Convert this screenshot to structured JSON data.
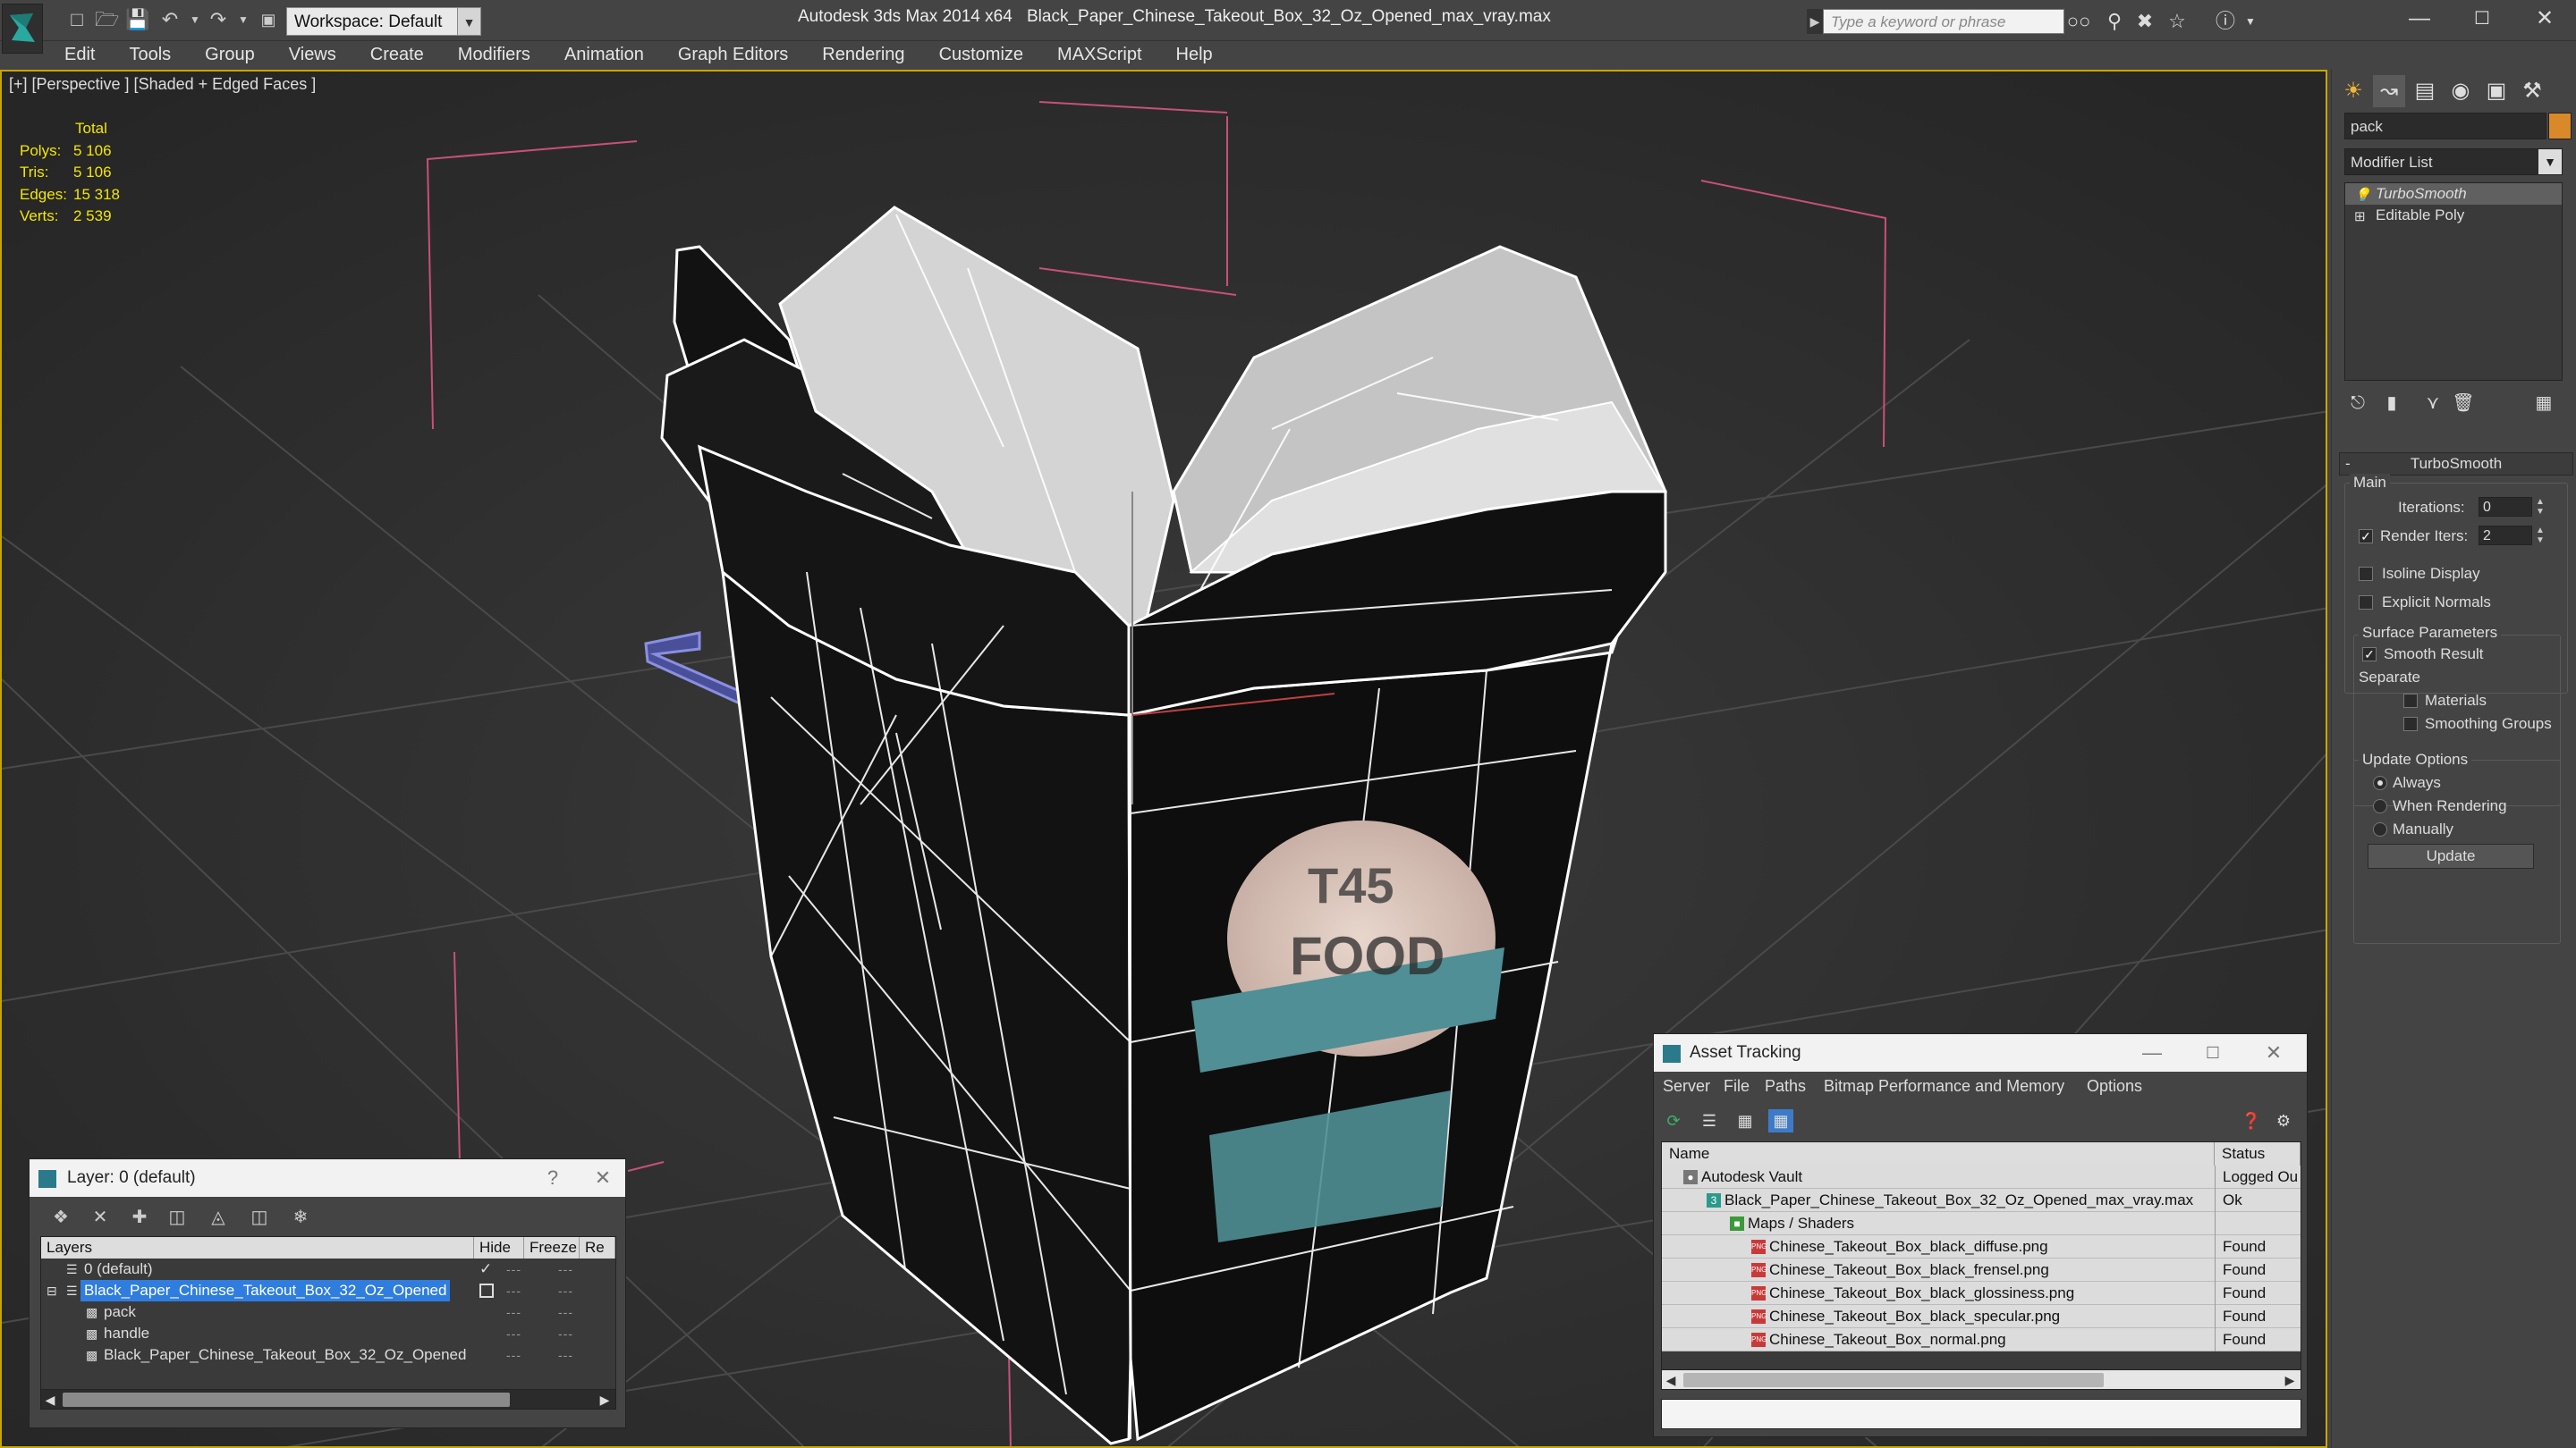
{
  "app": {
    "title": "Autodesk 3ds Max  2014 x64",
    "file": "Black_Paper_Chinese_Takeout_Box_32_Oz_Opened_max_vray.max",
    "workspace": "Workspace: Default",
    "search_placeholder": "Type a keyword or phrase"
  },
  "menu": [
    "Edit",
    "Tools",
    "Group",
    "Views",
    "Create",
    "Modifiers",
    "Animation",
    "Graph Editors",
    "Rendering",
    "Customize",
    "MAXScript",
    "Help"
  ],
  "viewport": {
    "label": "[+] [Perspective ] [Shaded + Edged Faces ]",
    "stats_header": "Total",
    "stats": [
      {
        "k": "Polys:",
        "v": "5 106"
      },
      {
        "k": "Tris:",
        "v": "5 106"
      },
      {
        "k": "Edges:",
        "v": "15 318"
      },
      {
        "k": "Verts:",
        "v": "2 539"
      }
    ],
    "colors": {
      "bg": "#2e2e2e",
      "grid": "#4a4a4a",
      "wire": "#ffffff",
      "box_dark": "#111111",
      "box_light": "#d9d9d9",
      "gizmo": "#c8507a"
    }
  },
  "command_panel": {
    "object_name": "pack",
    "object_color": "#d9892a",
    "modifier_list": "Modifier List",
    "stack": [
      "TurboSmooth",
      "Editable Poly"
    ],
    "rollout_title": "TurboSmooth",
    "main_label": "Main",
    "iterations_label": "Iterations:",
    "iterations_value": "0",
    "render_iters_label": "Render Iters:",
    "render_iters_value": "2",
    "isoline_label": "Isoline Display",
    "explicit_normals_label": "Explicit Normals",
    "surface_params_label": "Surface Parameters",
    "smooth_result_label": "Smooth Result",
    "separate_label": "Separate",
    "materials_label": "Materials",
    "smoothing_groups_label": "Smoothing Groups",
    "update_options_label": "Update Options",
    "always_label": "Always",
    "when_rendering_label": "When Rendering",
    "manually_label": "Manually",
    "update_button": "Update",
    "render_iters_checked": true,
    "isoline_checked": false,
    "explicit_normals_checked": false,
    "smooth_result_checked": true,
    "update_option_selected": "Always"
  },
  "layer_dialog": {
    "title": "Layer: 0 (default)",
    "help": "?",
    "columns": [
      "Layers",
      "Hide",
      "Freeze",
      "Re"
    ],
    "rows": [
      {
        "name": "0 (default)",
        "indent": 0
      },
      {
        "name": "Black_Paper_Chinese_Takeout_Box_32_Oz_Opened",
        "indent": 0,
        "selected": true
      },
      {
        "name": "pack",
        "indent": 1
      },
      {
        "name": "handle",
        "indent": 1
      },
      {
        "name": "Black_Paper_Chinese_Takeout_Box_32_Oz_Opened",
        "indent": 1
      }
    ]
  },
  "asset_dialog": {
    "title": "Asset Tracking",
    "menu": [
      "Server",
      "File",
      "Paths",
      "Bitmap Performance and Memory",
      "Options"
    ],
    "columns": [
      "Name",
      "Status"
    ],
    "rows": [
      {
        "name": "Autodesk Vault",
        "status": "Logged Ou",
        "indent": 0
      },
      {
        "name": "Black_Paper_Chinese_Takeout_Box_32_Oz_Opened_max_vray.max",
        "status": "Ok",
        "indent": 1
      },
      {
        "name": "Maps / Shaders",
        "status": "",
        "indent": 2
      },
      {
        "name": "Chinese_Takeout_Box_black_diffuse.png",
        "status": "Found",
        "indent": 3
      },
      {
        "name": "Chinese_Takeout_Box_black_frensel.png",
        "status": "Found",
        "indent": 3
      },
      {
        "name": "Chinese_Takeout_Box_black_glossiness.png",
        "status": "Found",
        "indent": 3
      },
      {
        "name": "Chinese_Takeout_Box_black_specular.png",
        "status": "Found",
        "indent": 3
      },
      {
        "name": "Chinese_Takeout_Box_normal.png",
        "status": "Found",
        "indent": 3
      }
    ]
  }
}
